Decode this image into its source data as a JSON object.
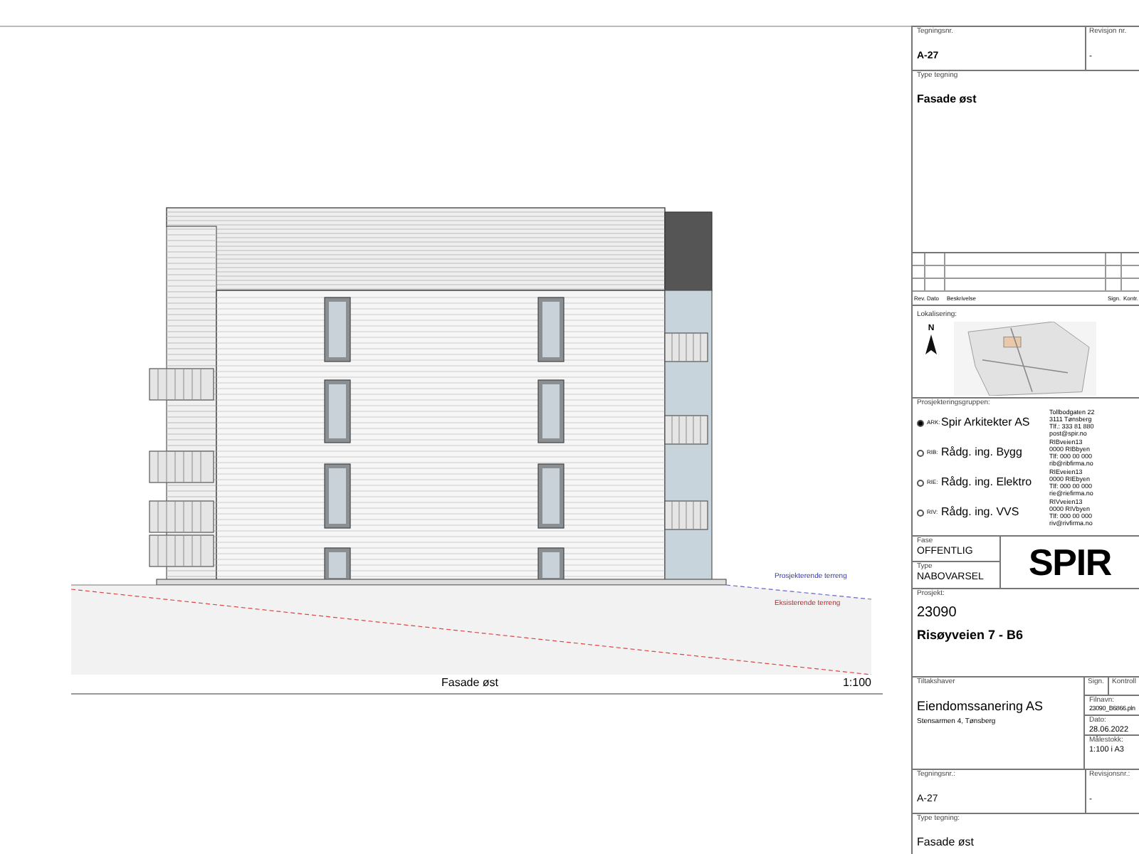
{
  "drawing": {
    "terrain_labels": [
      {
        "kind": "planned",
        "text": "Prosjekterende terreng"
      },
      {
        "kind": "existing",
        "text": "Eksisterende terreng"
      }
    ],
    "caption": "Fasade øst",
    "scale": "1:100"
  },
  "title_block": {
    "top": {
      "drawing_no_label": "Tegningsnr.",
      "drawing_no": "A-27",
      "revision_label": "Revisjon nr.",
      "revision": "-",
      "type_label": "Type tegning",
      "type": "Fasade øst"
    },
    "revision_table": {
      "columns": [
        "Rev.",
        "Dato",
        "Beskrivelse",
        "Sign.",
        "Kontr."
      ]
    },
    "location": {
      "label": "Lokalisering:",
      "north": "N"
    },
    "team": {
      "label": "Prosjekteringsgruppen:",
      "members": [
        {
          "code": "ARK:",
          "name": "Spir Arkitekter AS",
          "selected": true,
          "address": [
            "Tollbodgaten 22",
            "3111 Tønsberg",
            "Tlf.: 333 81 880",
            "post@spir.no"
          ]
        },
        {
          "code": "RIB:",
          "name": "Rådg. ing. Bygg",
          "selected": false,
          "address": [
            "RIBveien13",
            "0000 RIBbyen",
            "Tlf: 000 00 000",
            "rib@ribfirma.no"
          ]
        },
        {
          "code": "RIE:",
          "name": "Rådg. ing. Elektro",
          "selected": false,
          "address": [
            "RIEveien13",
            "0000 RIEbyen",
            "Tlf: 000 00 000",
            "rie@riefirma.no"
          ]
        },
        {
          "code": "RIV:",
          "name": "Rådg. ing. VVS",
          "selected": false,
          "address": [
            "RIVveien13",
            "0000 RIVbyen",
            "Tlf: 000 00 000",
            "riv@rivfirma.no"
          ]
        }
      ]
    },
    "phase": {
      "label": "Fase",
      "value": "OFFENTLIG",
      "type_label": "Type",
      "type": "NABOVARSEL",
      "logo": "SPIR"
    },
    "project": {
      "label": "Prosjekt:",
      "number": "23090",
      "name": "Risøyveien 7 - B6"
    },
    "client": {
      "label": "Tiltakshaver",
      "name": "Eiendomssanering AS",
      "address": "Stensarmen 4, Tønsberg",
      "sign_label": "Sign.",
      "control_label": "Kontroll",
      "file_label": "Filnavn:",
      "file": "23090_B6866.pln",
      "date_label": "Dato:",
      "date": "28.06.2022",
      "scale_label": "Målestokk:",
      "scale": "1:100 i A3"
    },
    "bottom": {
      "drawing_no_label": "Tegningsnr.:",
      "drawing_no": "A-27",
      "revision_label": "Revisjonsnr.:",
      "revision": "-",
      "type_label": "Type tegning:",
      "type": "Fasade øst"
    }
  }
}
